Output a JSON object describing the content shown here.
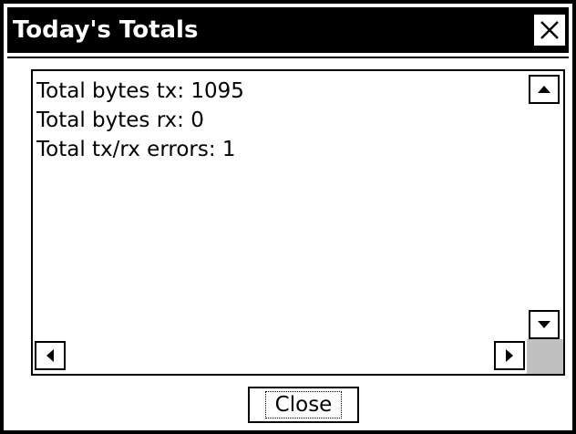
{
  "window": {
    "title": "Today's Totals",
    "close_glyph": "✕"
  },
  "content": {
    "lines": [
      "Total bytes tx: 1095",
      "Total bytes rx: 0",
      "Total tx/rx errors: 1"
    ]
  },
  "scrollbar": {
    "up_icon": "triangle-up",
    "down_icon": "triangle-down",
    "left_icon": "triangle-left",
    "right_icon": "triangle-right"
  },
  "buttons": {
    "close_label": "Close"
  }
}
